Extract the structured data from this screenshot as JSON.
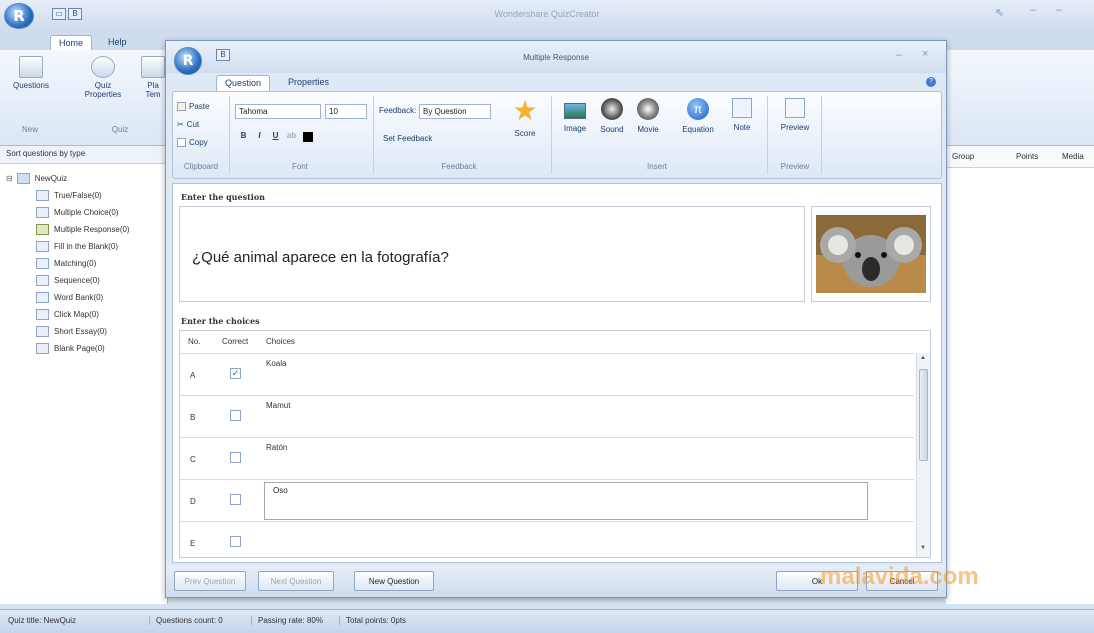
{
  "main": {
    "title": "Wondershare QuizCreator",
    "tabs": [
      "Home",
      "Help"
    ],
    "ribbon": {
      "questions_label": "Questions",
      "quiz_properties_label": "Quiz Properties",
      "pla_label": "Pla",
      "tem_label": "Tem",
      "group_new": "New",
      "group_quiz": "Quiz"
    },
    "left_panel": {
      "sort_label": "Sort questions by type",
      "root": "NewQuiz",
      "items": [
        "True/False(0)",
        "Multiple Choice(0)",
        "Multiple Response(0)",
        "Fill in the Blank(0)",
        "Matching(0)",
        "Sequence(0)",
        "Word Bank(0)",
        "Click Map(0)",
        "Short Essay(0)",
        "Blank Page(0)"
      ]
    },
    "right_columns": [
      "Group",
      "Points",
      "Media"
    ],
    "status": {
      "quiz_title": "Quiz title: NewQuiz",
      "questions_count": "Questions count: 0",
      "passing_rate": "Passing rate: 80%",
      "total_points": "Total points: 0pts"
    }
  },
  "dialog": {
    "title": "Multiple Response",
    "tabs": [
      "Question",
      "Properties"
    ],
    "clipboard": {
      "paste": "Paste",
      "cut": "Cut",
      "copy": "Copy",
      "label": "Clipboard"
    },
    "font": {
      "family": "Tahoma",
      "size": "10",
      "label": "Font"
    },
    "feedback": {
      "label_prefix": "Feedback:",
      "value": "By Question",
      "set": "Set Feedback",
      "group": "Feedback"
    },
    "score_label": "Score",
    "insert": {
      "image": "Image",
      "sound": "Sound",
      "movie": "Movie",
      "equation": "Equation",
      "note": "Note",
      "label": "Insert"
    },
    "preview": {
      "button": "Preview",
      "label": "Preview"
    },
    "question_section_label": "Enter the question",
    "question_text": "¿Qué animal aparece en la fotografía?",
    "choices_section_label": "Enter the choices",
    "choices_headers": [
      "No.",
      "Correct",
      "Choices"
    ],
    "choices": [
      {
        "no": "A",
        "correct": true,
        "text": "Koala"
      },
      {
        "no": "B",
        "correct": false,
        "text": "Mamut"
      },
      {
        "no": "C",
        "correct": false,
        "text": "Ratón"
      },
      {
        "no": "D",
        "correct": false,
        "text": "Oso"
      },
      {
        "no": "E",
        "correct": false,
        "text": ""
      }
    ],
    "footer": {
      "prev": "Prev Question",
      "next": "Next Question",
      "new": "New Question",
      "ok": "Ok",
      "cancel": "Cancel"
    }
  },
  "watermark": "malavida.com"
}
